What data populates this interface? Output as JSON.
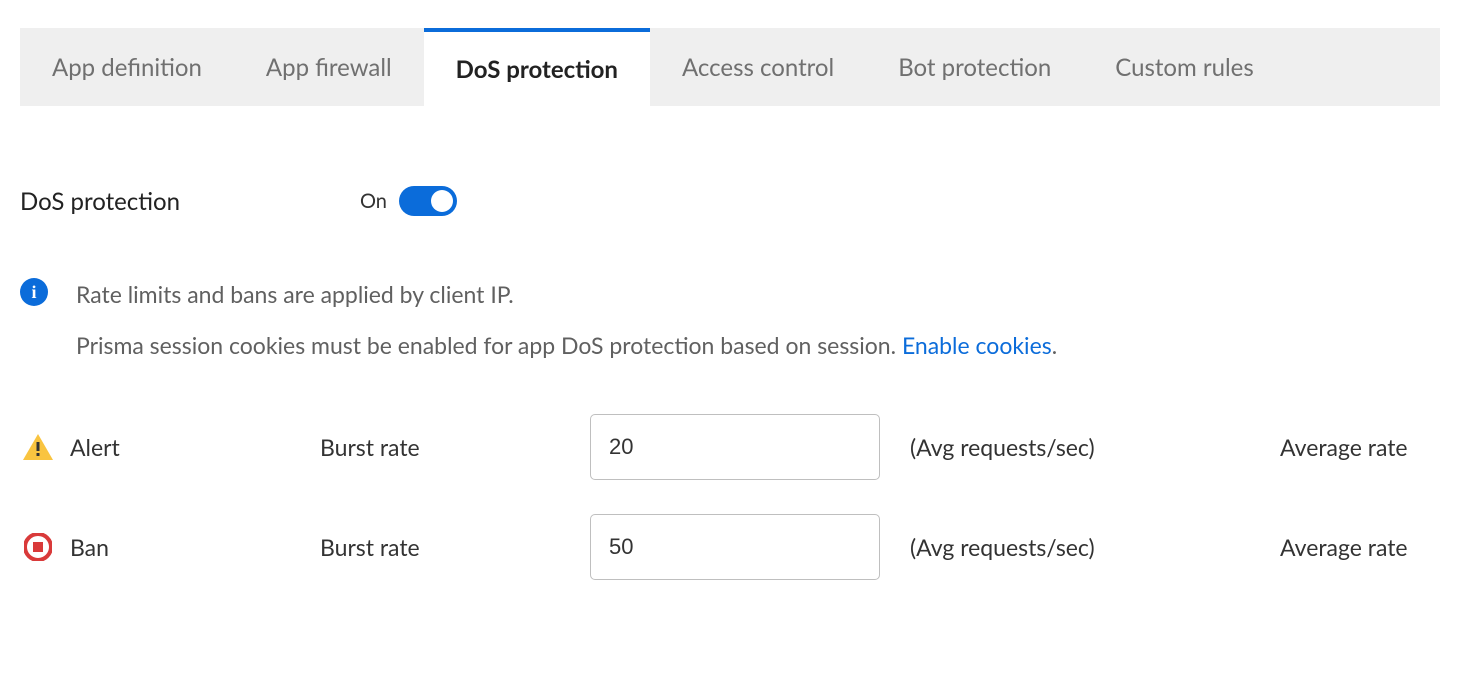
{
  "tabs": [
    {
      "label": "App definition",
      "active": false
    },
    {
      "label": "App firewall",
      "active": false
    },
    {
      "label": "DoS protection",
      "active": true
    },
    {
      "label": "Access control",
      "active": false
    },
    {
      "label": "Bot protection",
      "active": false
    },
    {
      "label": "Custom rules",
      "active": false
    }
  ],
  "section": {
    "title": "DoS protection",
    "toggle_label": "On",
    "toggle_on": true
  },
  "info": {
    "line1": "Rate limits and bans are applied by client IP.",
    "line2_prefix": "Prisma session cookies must be enabled for app DoS protection based on session. ",
    "link_text": "Enable cookies",
    "link_suffix": "."
  },
  "alert": {
    "label": "Alert",
    "burst_label": "Burst rate",
    "burst_value": "20",
    "unit": "(Avg requests/sec)",
    "avg_label": "Average rate"
  },
  "ban": {
    "label": "Ban",
    "burst_label": "Burst rate",
    "burst_value": "50",
    "unit": "(Avg requests/sec)",
    "avg_label": "Average rate"
  },
  "colors": {
    "accent": "#0b6cda",
    "tab_bg": "#efefef",
    "text_muted": "#606060",
    "warning": "#f9c440",
    "danger": "#d93a3a"
  }
}
